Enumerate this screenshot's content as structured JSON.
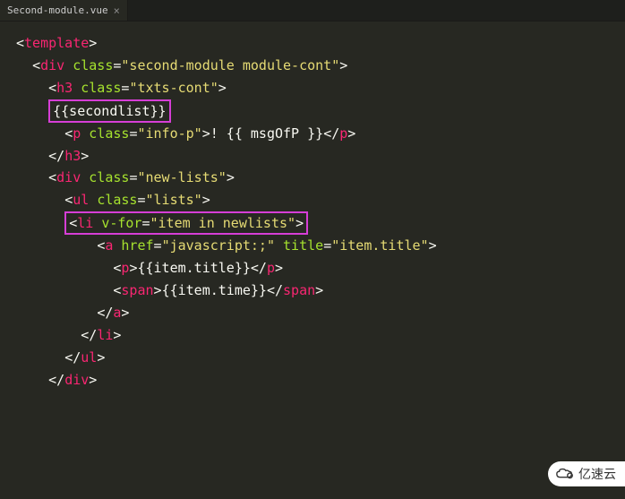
{
  "tab": {
    "filename": "Second-module.vue",
    "close": "×"
  },
  "code": {
    "l1_open": "<",
    "l1_tag": "template",
    "l1_close": ">",
    "l2_open": "<",
    "l2_tag": "div",
    "l2_attr": "class",
    "l2_eq": "=",
    "l2_val": "\"second-module module-cont\"",
    "l2_close": ">",
    "l3_open": "<",
    "l3_tag": "h3",
    "l3_attr": "class",
    "l3_eq": "=",
    "l3_val": "\"txts-cont\"",
    "l3_close": ">",
    "l4_mustache": "{{secondlist}}",
    "l5_open": "<",
    "l5_tag": "p",
    "l5_attr": "class",
    "l5_eq": "=",
    "l5_val": "\"info-p\"",
    "l5_close": ">",
    "l5_text": "! {{ msgOfP }}",
    "l5_endopen": "</",
    "l5_endtag": "p",
    "l5_endclose": ">",
    "l6_open": "</",
    "l6_tag": "h3",
    "l6_close": ">",
    "l7_open": "<",
    "l7_tag": "div",
    "l7_attr": "class",
    "l7_eq": "=",
    "l7_val": "\"new-lists\"",
    "l7_close": ">",
    "l8_open": "<",
    "l8_tag": "ul",
    "l8_attr": "class",
    "l8_eq": "=",
    "l8_val": "\"lists\"",
    "l8_close": ">",
    "l9_open": "<",
    "l9_tag": "li",
    "l9_attr": "v-for",
    "l9_eq": "=",
    "l9_val": "\"item in newlists\"",
    "l9_close": ">",
    "l10_open": "<",
    "l10_tag": "a",
    "l10_attr1": "href",
    "l10_eq1": "=",
    "l10_val1": "\"javascript:;\"",
    "l10_attr2": "title",
    "l10_eq2": "=",
    "l10_val2": "\"item.title\"",
    "l10_close": ">",
    "l11_open": "<",
    "l11_tag": "p",
    "l11_close": ">",
    "l11_text": "{{item.title}}",
    "l11_endopen": "</",
    "l11_endtag": "p",
    "l11_endclose": ">",
    "l12_open": "<",
    "l12_tag": "span",
    "l12_close": ">",
    "l12_text": "{{item.time}}",
    "l12_endopen": "</",
    "l12_endtag": "span",
    "l12_endclose": ">",
    "l13_open": "</",
    "l13_tag": "a",
    "l13_close": ">",
    "l14_open": "</",
    "l14_tag": "li",
    "l14_close": ">",
    "l15_open": "</",
    "l15_tag": "ul",
    "l15_close": ">",
    "l16_open": "</",
    "l16_tag": "div",
    "l16_close": ">"
  },
  "watermark": {
    "text": "亿速云"
  },
  "indent": {
    "i1": "  ",
    "i2": "    ",
    "i3": "      ",
    "i4": "        ",
    "i5": "          ",
    "i6": "            "
  }
}
